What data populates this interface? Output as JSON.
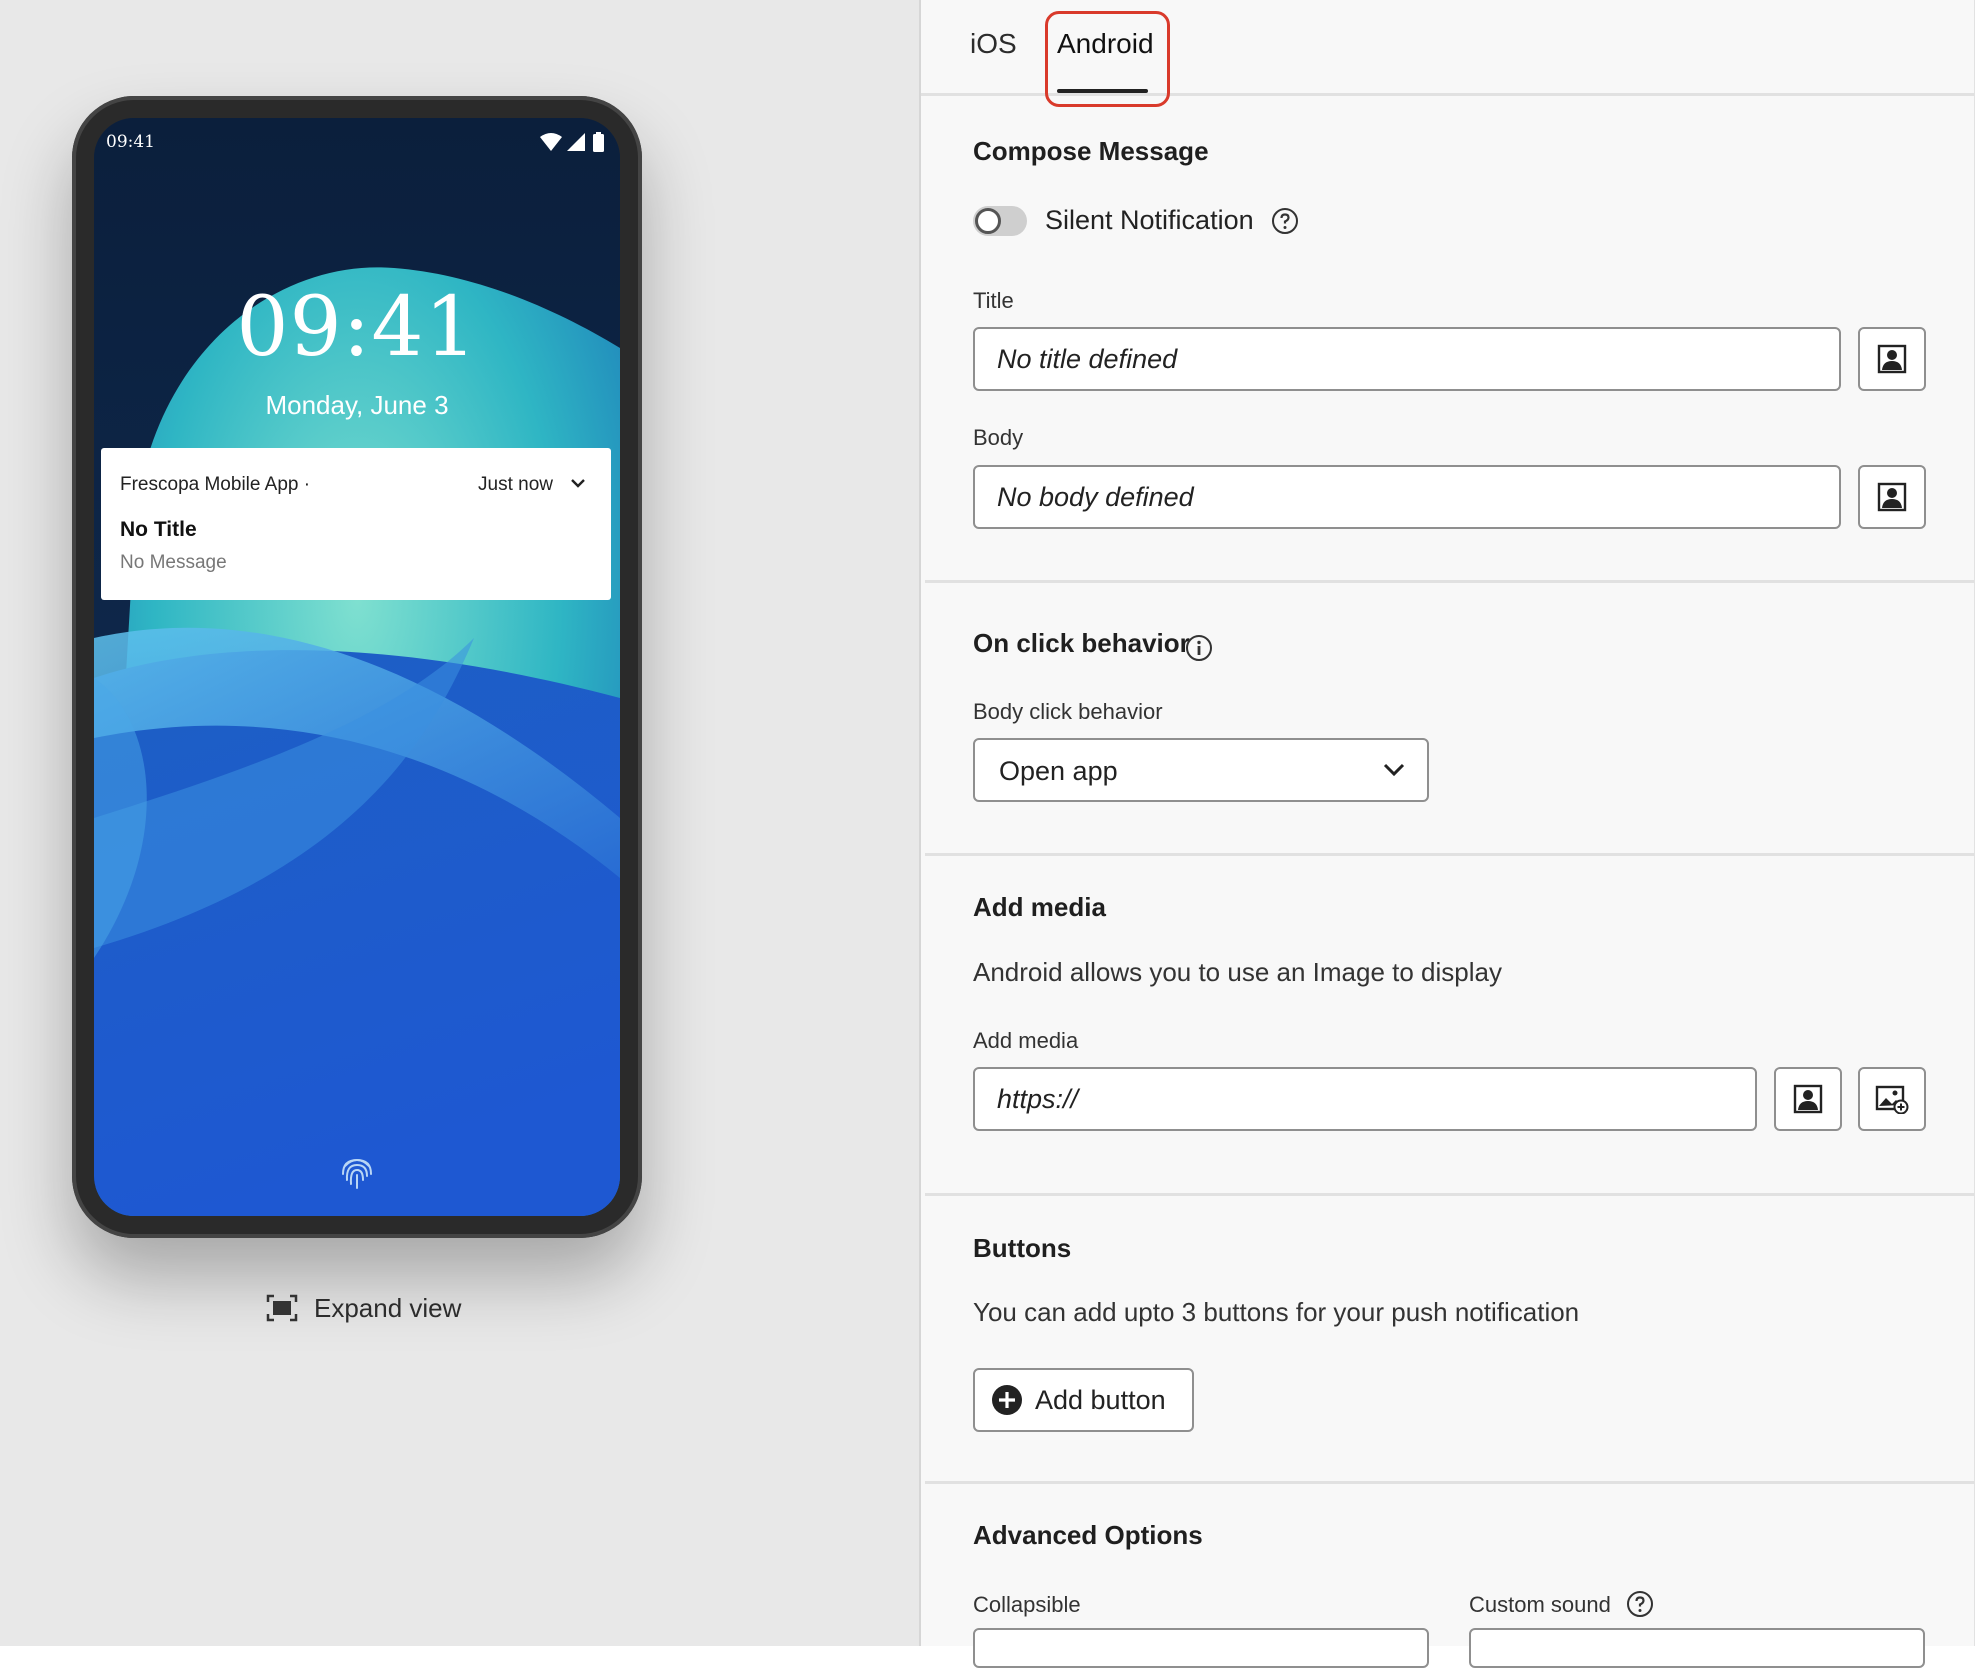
{
  "preview": {
    "status_time": "09:41",
    "lock_time": "09:41",
    "lock_date": "Monday, June 3",
    "notification": {
      "app_name": "Frescopa Mobile App ·",
      "time": "Just now",
      "title": "No Title",
      "message": "No Message"
    },
    "expand_label": "Expand view"
  },
  "tabs": [
    {
      "label": "iOS",
      "selected": false
    },
    {
      "label": "Android",
      "selected": true
    }
  ],
  "compose": {
    "section_title": "Compose Message",
    "silent_label": "Silent Notification",
    "silent_enabled": false,
    "title_label": "Title",
    "title_placeholder": "No title defined",
    "body_label": "Body",
    "body_placeholder": "No body defined"
  },
  "on_click": {
    "section_title": "On click behavior",
    "field_label": "Body click behavior",
    "selected": "Open app"
  },
  "media": {
    "section_title": "Add media",
    "helper": "Android allows you to use an Image to display",
    "field_label": "Add media",
    "placeholder": "https://"
  },
  "buttons": {
    "section_title": "Buttons",
    "helper": "You can add upto 3 buttons for your push notification",
    "add_label": "Add button"
  },
  "advanced": {
    "section_title": "Advanced Options",
    "collapsible_label": "Collapsible",
    "custom_sound_label": "Custom sound"
  },
  "colors": {
    "tab_highlight": "#d93a2b",
    "panel_bg": "#f8f8f8",
    "preview_bg": "#e8e8e8"
  }
}
